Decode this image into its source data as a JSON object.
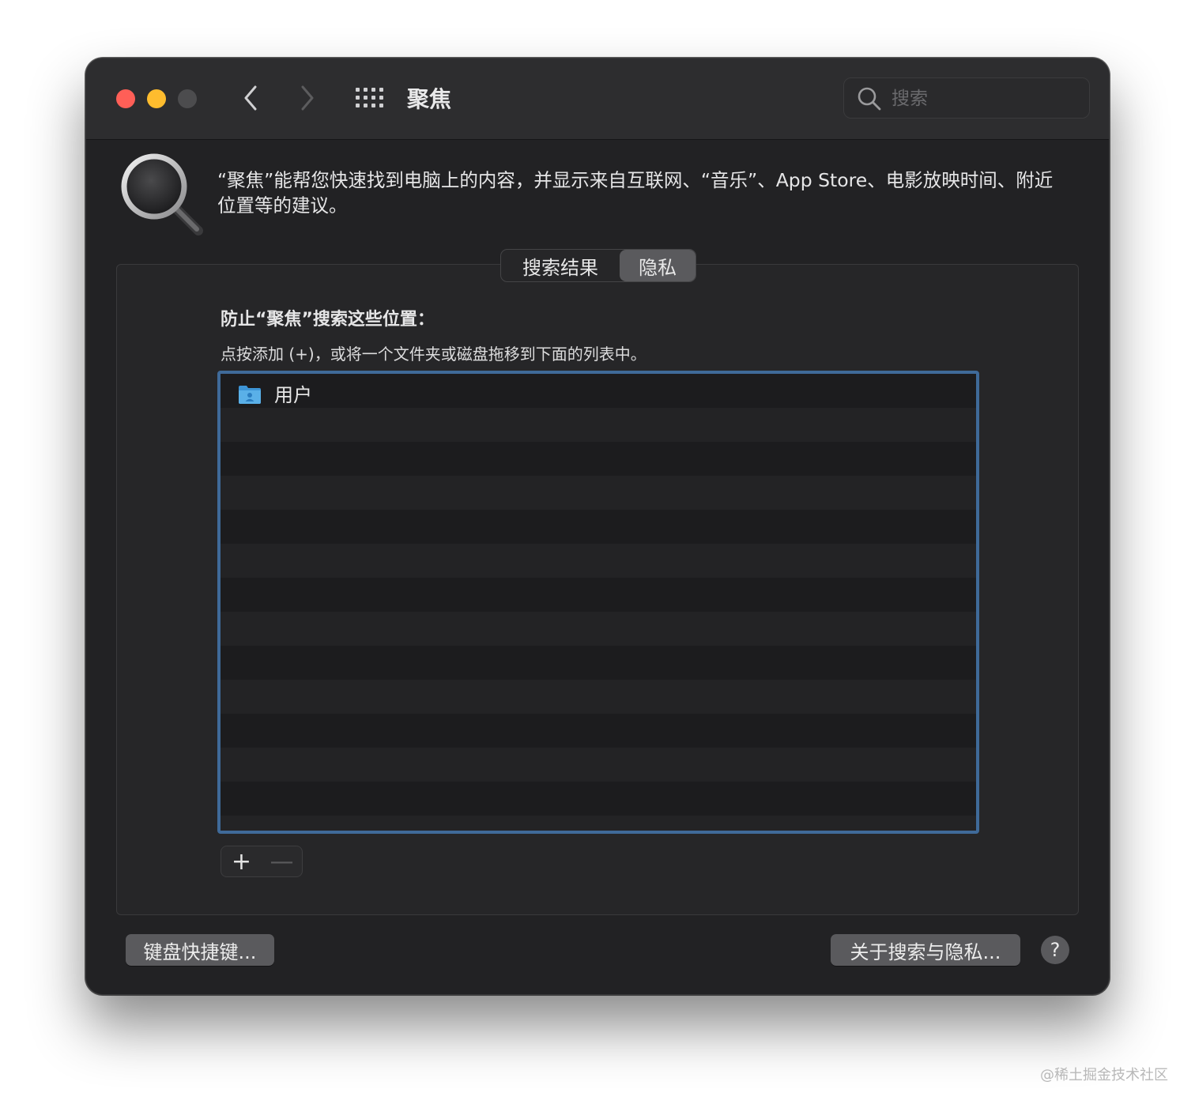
{
  "window": {
    "title": "聚焦",
    "search": {
      "placeholder": "搜索",
      "value": ""
    },
    "traffic_lights": [
      "close",
      "minimize",
      "zoom-disabled"
    ]
  },
  "header": {
    "description": "“聚焦”能帮您快速找到电脑上的内容，并显示来自互联网、“音乐”、App Store、电影放映时间、附近位置等的建议。"
  },
  "tabs": {
    "items": [
      {
        "label": "搜索结果",
        "selected": false
      },
      {
        "label": "隐私",
        "selected": true
      }
    ]
  },
  "privacy": {
    "heading": "防止“聚焦”搜索这些位置：",
    "hint": "点按添加 (+)，或将一个文件夹或磁盘拖移到下面的列表中。",
    "list": [
      {
        "label": "用户",
        "icon": "user-folder-icon"
      }
    ],
    "add_label": "+",
    "remove_label": "—"
  },
  "footer": {
    "keyboard_shortcuts_label": "键盘快捷键...",
    "about_label": "关于搜索与隐私...",
    "help_label": "?"
  },
  "watermark": "@稀土掘金技术社区",
  "colors": {
    "close": "#ff5f57",
    "minimize": "#febc2e",
    "accent_border": "#3f6a99",
    "folder": "#5ab0e8"
  }
}
